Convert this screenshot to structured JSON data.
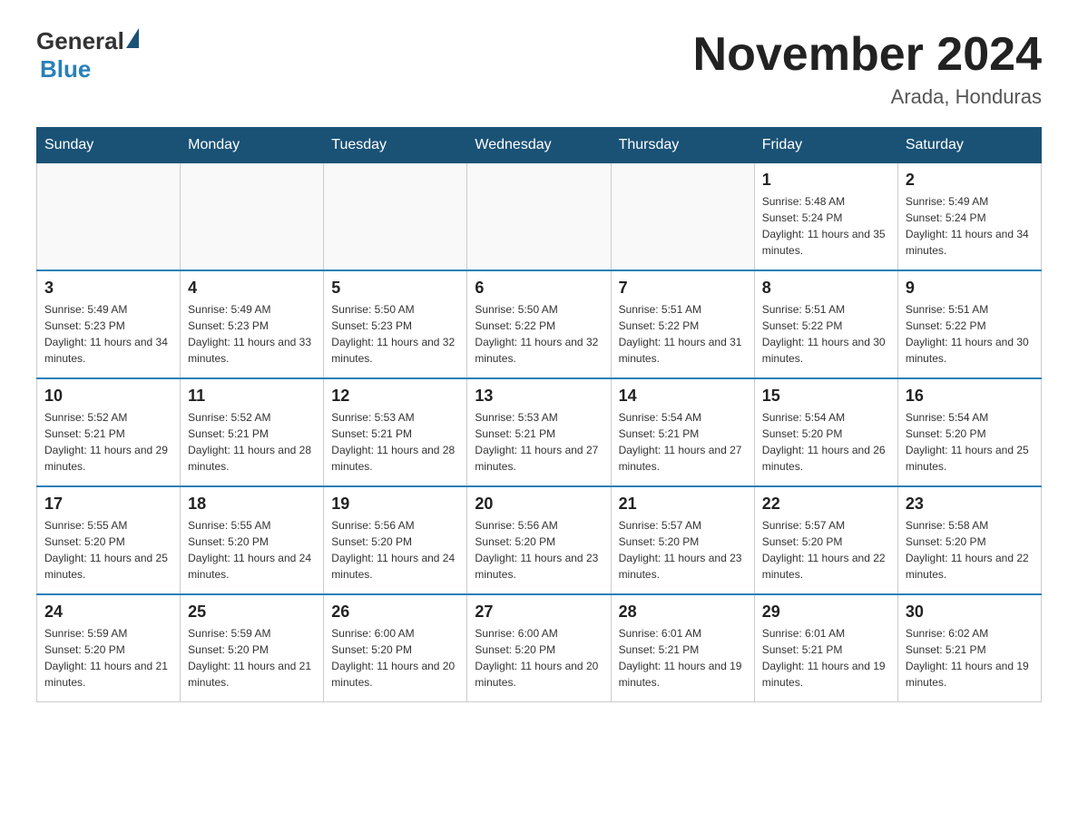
{
  "header": {
    "logo": {
      "general": "General",
      "blue": "Blue"
    },
    "title": "November 2024",
    "subtitle": "Arada, Honduras"
  },
  "weekdays": [
    "Sunday",
    "Monday",
    "Tuesday",
    "Wednesday",
    "Thursday",
    "Friday",
    "Saturday"
  ],
  "weeks": [
    [
      {
        "day": "",
        "info": ""
      },
      {
        "day": "",
        "info": ""
      },
      {
        "day": "",
        "info": ""
      },
      {
        "day": "",
        "info": ""
      },
      {
        "day": "",
        "info": ""
      },
      {
        "day": "1",
        "info": "Sunrise: 5:48 AM\nSunset: 5:24 PM\nDaylight: 11 hours and 35 minutes."
      },
      {
        "day": "2",
        "info": "Sunrise: 5:49 AM\nSunset: 5:24 PM\nDaylight: 11 hours and 34 minutes."
      }
    ],
    [
      {
        "day": "3",
        "info": "Sunrise: 5:49 AM\nSunset: 5:23 PM\nDaylight: 11 hours and 34 minutes."
      },
      {
        "day": "4",
        "info": "Sunrise: 5:49 AM\nSunset: 5:23 PM\nDaylight: 11 hours and 33 minutes."
      },
      {
        "day": "5",
        "info": "Sunrise: 5:50 AM\nSunset: 5:23 PM\nDaylight: 11 hours and 32 minutes."
      },
      {
        "day": "6",
        "info": "Sunrise: 5:50 AM\nSunset: 5:22 PM\nDaylight: 11 hours and 32 minutes."
      },
      {
        "day": "7",
        "info": "Sunrise: 5:51 AM\nSunset: 5:22 PM\nDaylight: 11 hours and 31 minutes."
      },
      {
        "day": "8",
        "info": "Sunrise: 5:51 AM\nSunset: 5:22 PM\nDaylight: 11 hours and 30 minutes."
      },
      {
        "day": "9",
        "info": "Sunrise: 5:51 AM\nSunset: 5:22 PM\nDaylight: 11 hours and 30 minutes."
      }
    ],
    [
      {
        "day": "10",
        "info": "Sunrise: 5:52 AM\nSunset: 5:21 PM\nDaylight: 11 hours and 29 minutes."
      },
      {
        "day": "11",
        "info": "Sunrise: 5:52 AM\nSunset: 5:21 PM\nDaylight: 11 hours and 28 minutes."
      },
      {
        "day": "12",
        "info": "Sunrise: 5:53 AM\nSunset: 5:21 PM\nDaylight: 11 hours and 28 minutes."
      },
      {
        "day": "13",
        "info": "Sunrise: 5:53 AM\nSunset: 5:21 PM\nDaylight: 11 hours and 27 minutes."
      },
      {
        "day": "14",
        "info": "Sunrise: 5:54 AM\nSunset: 5:21 PM\nDaylight: 11 hours and 27 minutes."
      },
      {
        "day": "15",
        "info": "Sunrise: 5:54 AM\nSunset: 5:20 PM\nDaylight: 11 hours and 26 minutes."
      },
      {
        "day": "16",
        "info": "Sunrise: 5:54 AM\nSunset: 5:20 PM\nDaylight: 11 hours and 25 minutes."
      }
    ],
    [
      {
        "day": "17",
        "info": "Sunrise: 5:55 AM\nSunset: 5:20 PM\nDaylight: 11 hours and 25 minutes."
      },
      {
        "day": "18",
        "info": "Sunrise: 5:55 AM\nSunset: 5:20 PM\nDaylight: 11 hours and 24 minutes."
      },
      {
        "day": "19",
        "info": "Sunrise: 5:56 AM\nSunset: 5:20 PM\nDaylight: 11 hours and 24 minutes."
      },
      {
        "day": "20",
        "info": "Sunrise: 5:56 AM\nSunset: 5:20 PM\nDaylight: 11 hours and 23 minutes."
      },
      {
        "day": "21",
        "info": "Sunrise: 5:57 AM\nSunset: 5:20 PM\nDaylight: 11 hours and 23 minutes."
      },
      {
        "day": "22",
        "info": "Sunrise: 5:57 AM\nSunset: 5:20 PM\nDaylight: 11 hours and 22 minutes."
      },
      {
        "day": "23",
        "info": "Sunrise: 5:58 AM\nSunset: 5:20 PM\nDaylight: 11 hours and 22 minutes."
      }
    ],
    [
      {
        "day": "24",
        "info": "Sunrise: 5:59 AM\nSunset: 5:20 PM\nDaylight: 11 hours and 21 minutes."
      },
      {
        "day": "25",
        "info": "Sunrise: 5:59 AM\nSunset: 5:20 PM\nDaylight: 11 hours and 21 minutes."
      },
      {
        "day": "26",
        "info": "Sunrise: 6:00 AM\nSunset: 5:20 PM\nDaylight: 11 hours and 20 minutes."
      },
      {
        "day": "27",
        "info": "Sunrise: 6:00 AM\nSunset: 5:20 PM\nDaylight: 11 hours and 20 minutes."
      },
      {
        "day": "28",
        "info": "Sunrise: 6:01 AM\nSunset: 5:21 PM\nDaylight: 11 hours and 19 minutes."
      },
      {
        "day": "29",
        "info": "Sunrise: 6:01 AM\nSunset: 5:21 PM\nDaylight: 11 hours and 19 minutes."
      },
      {
        "day": "30",
        "info": "Sunrise: 6:02 AM\nSunset: 5:21 PM\nDaylight: 11 hours and 19 minutes."
      }
    ]
  ]
}
